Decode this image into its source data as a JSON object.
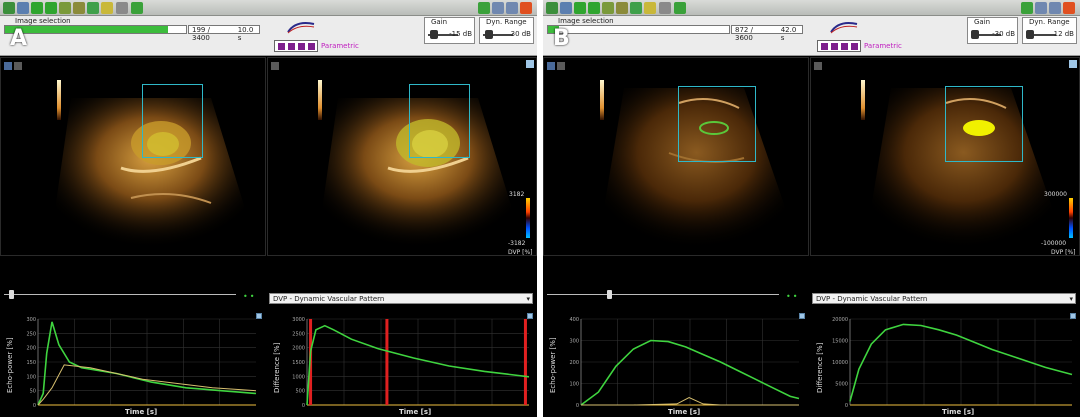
{
  "panels": [
    {
      "letter": "A",
      "image_selection_label": "Image selection",
      "frame_counter": "199 / 3400",
      "frame_time": "10.0 s",
      "progress_fraction": 0.9,
      "parametric_label": "Parametric",
      "gain_label": "Gain",
      "gain_value": "-15 dB",
      "dyn_range_label": "Dyn. Range",
      "dyn_range_value": "30 dB",
      "colorbar_max": "3182",
      "colorbar_min": "-3182",
      "colorbar_unit": "DVP [%]",
      "dropdown_value": "DVP - Dynamic Vascular Pattern",
      "chart1_ylabel": "Echo-power [%]",
      "chart1_xlabel": "Time [s]",
      "chart2_ylabel": "Difference [%]",
      "chart2_xlabel": "Time [s]",
      "slider_fraction": 0.02
    },
    {
      "letter": "B",
      "image_selection_label": "Image selection",
      "frame_counter": "872 / 3600",
      "frame_time": "42.0 s",
      "progress_fraction": 0.06,
      "parametric_label": "Parametric",
      "gain_label": "Gain",
      "gain_value": "-30 dB",
      "dyn_range_label": "Dyn. Range",
      "dyn_range_value": "12 dB",
      "colorbar_max": "300000",
      "colorbar_min": "-100000",
      "colorbar_unit": "DVP [%]",
      "dropdown_value": "DVP - Dynamic Vascular Pattern",
      "chart1_ylabel": "Echo-power [%]",
      "chart1_xlabel": "Time [s]",
      "chart2_ylabel": "Difference [%]",
      "chart2_xlabel": "Time [s]",
      "slider_fraction": 0.26
    }
  ],
  "charts": {
    "a_echo": {
      "type": "line",
      "y_ticks": [
        "300",
        "250",
        "200",
        "150",
        "100",
        "50",
        "0"
      ],
      "series": [
        {
          "x": [
            0,
            3,
            5,
            8,
            12,
            18,
            25,
            35,
            45,
            55,
            65,
            75,
            85,
            95,
            105,
            115,
            125
          ],
          "y": [
            0,
            40,
            180,
            290,
            210,
            150,
            130,
            120,
            110,
            95,
            80,
            70,
            60,
            55,
            50,
            45,
            40
          ]
        },
        {
          "x": [
            0,
            3,
            8,
            15,
            30,
            45,
            60,
            80,
            100,
            125
          ],
          "y": [
            0,
            20,
            60,
            140,
            130,
            110,
            90,
            75,
            60,
            50
          ]
        }
      ],
      "xlim": [
        0,
        125
      ],
      "ylim": [
        0,
        300
      ]
    },
    "a_diff": {
      "type": "line",
      "y_ticks": [
        "3000",
        "2500",
        "2000",
        "1500",
        "1000",
        "500",
        "0"
      ],
      "series": [
        {
          "x": [
            0,
            2,
            5,
            10,
            15,
            25,
            40,
            60,
            80,
            100,
            125
          ],
          "y": [
            0,
            2000,
            2800,
            2950,
            2800,
            2450,
            2100,
            1750,
            1450,
            1250,
            1050
          ]
        }
      ],
      "markers": [
        2,
        45,
        123
      ],
      "xlim": [
        0,
        125
      ],
      "ylim": [
        0,
        3200
      ]
    },
    "b_echo": {
      "type": "line",
      "y_ticks": [
        "400",
        "300",
        "200",
        "100",
        "0"
      ],
      "series": [
        {
          "x": [
            0,
            10,
            20,
            30,
            40,
            50,
            60,
            70,
            80,
            90,
            100,
            110,
            120,
            125
          ],
          "y": [
            0,
            60,
            180,
            260,
            300,
            295,
            270,
            235,
            200,
            160,
            120,
            80,
            40,
            30
          ]
        },
        {
          "x": [
            0,
            30,
            55,
            62,
            70,
            80,
            125
          ],
          "y": [
            0,
            0,
            5,
            35,
            5,
            0,
            0
          ]
        }
      ],
      "xlim": [
        0,
        125
      ],
      "ylim": [
        0,
        400
      ]
    },
    "b_diff": {
      "type": "line",
      "y_ticks": [
        "20000",
        "15000",
        "10000",
        "5000",
        "0"
      ],
      "series": [
        {
          "x": [
            0,
            5,
            12,
            20,
            30,
            40,
            50,
            60,
            70,
            80,
            95,
            110,
            125
          ],
          "y": [
            0,
            9000,
            16000,
            20000,
            21500,
            21200,
            20000,
            18500,
            16500,
            14500,
            12000,
            9500,
            7500
          ]
        }
      ],
      "xlim": [
        0,
        125
      ],
      "ylim": [
        -1000,
        23000
      ]
    }
  },
  "colors": {
    "accent_green": "#3fd43f",
    "roi_cyan": "#2fb8c8",
    "parametric_magenta": "#c020c0",
    "marker_red": "#e02020"
  }
}
